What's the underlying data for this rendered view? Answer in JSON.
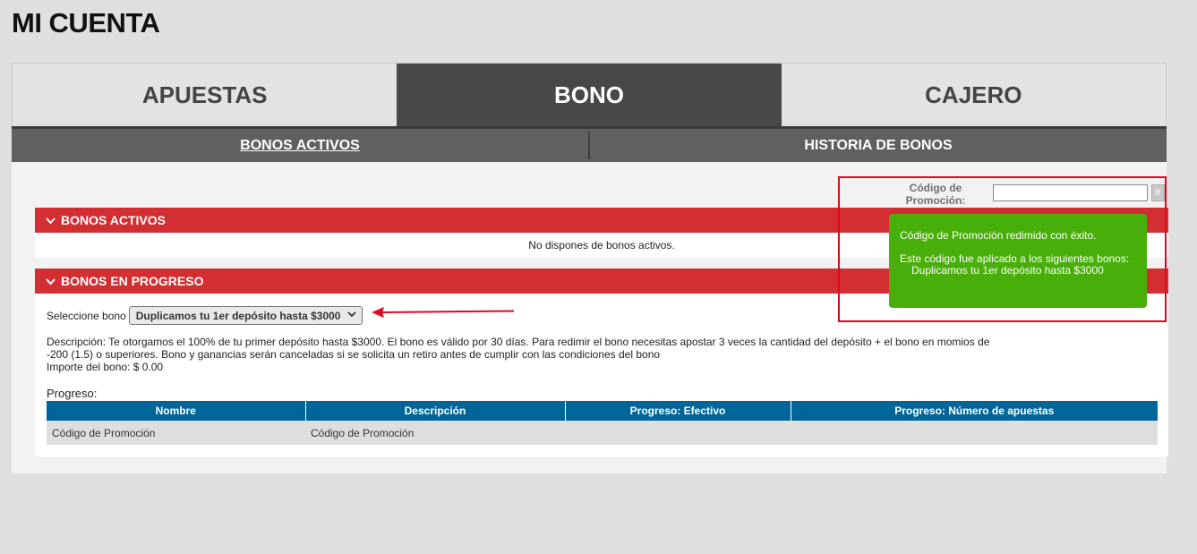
{
  "page_title": "MI CUENTA",
  "main_tabs": [
    {
      "label": "APUESTAS"
    },
    {
      "label": "BONO"
    },
    {
      "label": "CAJERO"
    }
  ],
  "sub_tabs": [
    {
      "label": "BONOS ACTIVOS"
    },
    {
      "label": "HISTORIA DE BONOS"
    }
  ],
  "promo": {
    "label": "Código de Promoción:",
    "value": "",
    "button_label": "Ir"
  },
  "sections": {
    "activos": {
      "title": "BONOS ACTIVOS",
      "empty_text": "No dispones de bonos activos."
    },
    "progreso": {
      "title": "BONOS EN PROGRESO"
    }
  },
  "select": {
    "label": "Seleccione bono",
    "selected": "Duplicamos tu 1er depósito hasta $3000"
  },
  "description": {
    "line1": "Descripción: Te otorgamos el 100% de tu primer depósito hasta $3000. El bono es válido por 30 días. Para redimir el bono necesitas apostar 3 veces la cantidad del depósito + el bono en momios de",
    "line2": "-200 (1.5) o superiores. Bono y ganancias serán canceladas si se solicita un retiro antes de cumplir con las condiciones del bono",
    "line3": "Importe del bono: $ 0.00"
  },
  "progreso_label": "Progreso:",
  "table": {
    "headers": [
      "Nombre",
      "Descripción",
      "Progreso: Efectivo",
      "Progreso: Número de apuestas"
    ],
    "rows": [
      [
        "Código de Promoción",
        "Código de Promoción",
        "",
        ""
      ]
    ]
  },
  "toast": {
    "line1": "Código de Promoción redimido con éxito.",
    "line2": "Este código fue aplicado a los siguientes bonos:",
    "item": "Duplicamos tu 1er depósito hasta $3000"
  },
  "colors": {
    "section_red": "#d32f33",
    "table_header_blue": "#006699",
    "toast_green": "#48ae09",
    "highlight_red": "#e3061d"
  }
}
